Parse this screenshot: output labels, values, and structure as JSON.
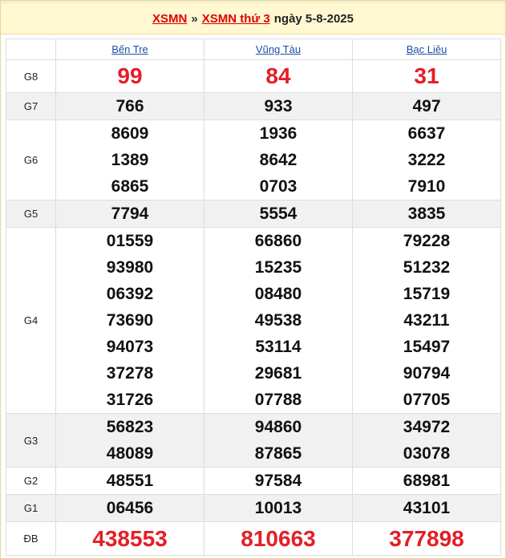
{
  "header": {
    "link1": "XSMN",
    "separator": "»",
    "link2": "XSMN thứ 3",
    "date_text": "ngày 5-8-2025"
  },
  "provinces": [
    "Bến Tre",
    "Vũng Tàu",
    "Bạc Liêu"
  ],
  "prizes": [
    {
      "label": "G8",
      "results": [
        [
          "99"
        ],
        [
          "84"
        ],
        [
          "31"
        ]
      ]
    },
    {
      "label": "G7",
      "results": [
        [
          "766"
        ],
        [
          "933"
        ],
        [
          "497"
        ]
      ]
    },
    {
      "label": "G6",
      "results": [
        [
          "8609",
          "1389",
          "6865"
        ],
        [
          "1936",
          "8642",
          "0703"
        ],
        [
          "6637",
          "3222",
          "7910"
        ]
      ]
    },
    {
      "label": "G5",
      "results": [
        [
          "7794"
        ],
        [
          "5554"
        ],
        [
          "3835"
        ]
      ]
    },
    {
      "label": "G4",
      "results": [
        [
          "01559",
          "93980",
          "06392",
          "73690",
          "94073",
          "37278",
          "31726"
        ],
        [
          "66860",
          "15235",
          "08480",
          "49538",
          "53114",
          "29681",
          "07788"
        ],
        [
          "79228",
          "51232",
          "15719",
          "43211",
          "15497",
          "90794",
          "07705"
        ]
      ]
    },
    {
      "label": "G3",
      "results": [
        [
          "56823",
          "48089"
        ],
        [
          "94860",
          "87865"
        ],
        [
          "34972",
          "03078"
        ]
      ]
    },
    {
      "label": "G2",
      "results": [
        [
          "48551"
        ],
        [
          "97584"
        ],
        [
          "68981"
        ]
      ]
    },
    {
      "label": "G1",
      "results": [
        [
          "06456"
        ],
        [
          "10013"
        ],
        [
          "43101"
        ]
      ]
    },
    {
      "label": "ĐB",
      "results": [
        [
          "438553"
        ],
        [
          "810663"
        ],
        [
          "377898"
        ]
      ]
    }
  ]
}
